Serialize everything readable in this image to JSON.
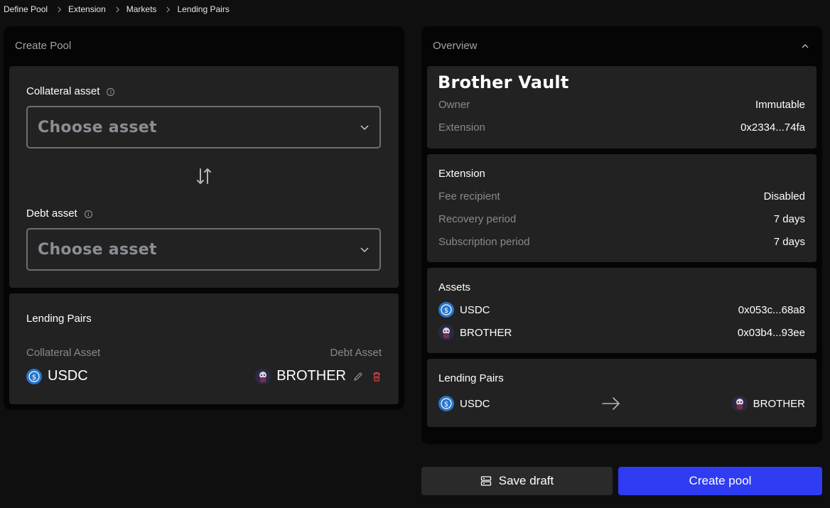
{
  "breadcrumb": [
    "Define Pool",
    "Extension",
    "Markets",
    "Lending Pairs"
  ],
  "create_pool": {
    "title": "Create Pool",
    "collateral_label": "Collateral asset",
    "collateral_placeholder": "Choose asset",
    "debt_label": "Debt asset",
    "debt_placeholder": "Choose asset",
    "info_glyph": "i",
    "lending_pairs": {
      "title": "Lending Pairs",
      "collateral_header": "Collateral Asset",
      "debt_header": "Debt Asset",
      "pair": {
        "collateral": "USDC",
        "debt": "BROTHER"
      }
    }
  },
  "overview": {
    "title": "Overview",
    "vault_name": "Brother Vault",
    "owner_label": "Owner",
    "owner_value": "Immutable",
    "extension_label": "Extension",
    "extension_value": "0x2334...74fa",
    "extension_section": {
      "title": "Extension",
      "fee_label": "Fee recipient",
      "fee_value": "Disabled",
      "recovery_label": "Recovery period",
      "recovery_value": "7 days",
      "subscription_label": "Subscription period",
      "subscription_value": "7 days"
    },
    "assets": {
      "title": "Assets",
      "items": [
        {
          "symbol": "USDC",
          "address": "0x053c...68a8"
        },
        {
          "symbol": "BROTHER",
          "address": "0x03b4...93ee"
        }
      ]
    },
    "lending_pairs": {
      "title": "Lending Pairs",
      "collateral": "USDC",
      "debt": "BROTHER"
    }
  },
  "actions": {
    "save_draft": "Save draft",
    "create_pool": "Create pool"
  },
  "colors": {
    "primary": "#2f3cf2",
    "usdc": "#2775ca",
    "delete": "#e04343"
  }
}
